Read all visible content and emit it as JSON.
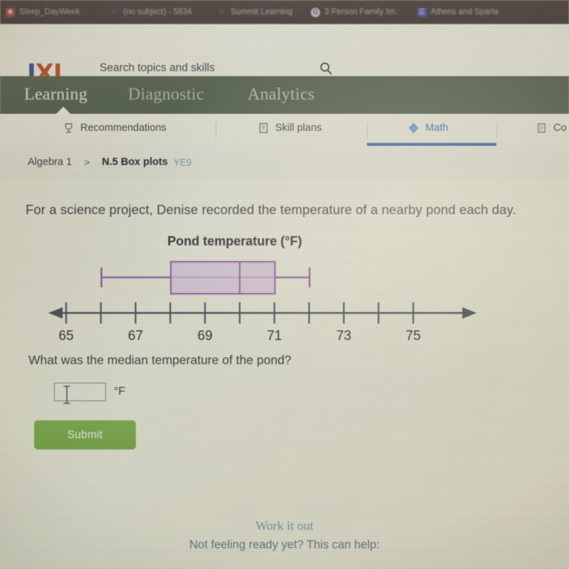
{
  "browser": {
    "bookmarks": [
      {
        "label": "Sleep_DayWeek",
        "icon": "red-dot-icon",
        "color": "#c4554a"
      },
      {
        "label": "(no subject) - 5834",
        "icon": "checkmark-icon",
        "color": "#6b5fd0"
      },
      {
        "label": "Summit Learning",
        "icon": "sun-burst-icon",
        "color": "#d05a4a"
      },
      {
        "label": "3 Person Family Im.",
        "icon": "google-g-icon",
        "color": "#e8e4e2"
      },
      {
        "label": "Athens and Sparta",
        "icon": "document-icon",
        "color": "#5a5fd8"
      }
    ]
  },
  "header": {
    "logo_i": "I",
    "logo_xl": "XL",
    "search_placeholder": "Search topics and skills",
    "search_value": "",
    "search_icon": "search-icon"
  },
  "main_nav": {
    "items": [
      {
        "label": "Learning",
        "active": true
      },
      {
        "label": "Diagnostic",
        "active": false
      },
      {
        "label": "Analytics",
        "active": false
      }
    ]
  },
  "sub_nav": {
    "items": [
      {
        "label": "Recommendations",
        "icon": "trophy-icon",
        "active": false
      },
      {
        "label": "Skill plans",
        "icon": "book-list-icon",
        "active": false
      },
      {
        "label": "Math",
        "icon": "diamond-icon",
        "active": true
      },
      {
        "label": "Co",
        "icon": "clipboard-icon",
        "active": false
      }
    ]
  },
  "breadcrumb": {
    "subject": "Algebra 1",
    "separator": ">",
    "skill": "N.5 Box plots",
    "code": "YE9"
  },
  "problem": {
    "prompt": "For a science project, Denise recorded the temperature of a nearby pond each day.",
    "question": "What was the median temperature of the pond?",
    "answer_value": "",
    "unit": "°F",
    "submit_label": "Submit"
  },
  "footer": {
    "work_it_out": "Work it out",
    "help_text": "Not feeling ready yet? This can help:"
  },
  "colors": {
    "box_fill": "#d9c2e3",
    "box_stroke": "#8f57a8",
    "axis": "#4a5260",
    "submit_green": "#7cb342",
    "active_blue": "#2f6fd0",
    "teal": "#6f9eb0"
  },
  "chart_data": {
    "type": "boxplot",
    "title": "Pond temperature (°F)",
    "xlabel": "",
    "ylabel": "",
    "xlim": [
      64.3,
      75.8
    ],
    "axis_ticks": [
      65,
      66,
      67,
      68,
      69,
      70,
      71,
      72,
      73,
      74,
      75
    ],
    "tick_labels": [
      "65",
      "",
      "67",
      "",
      "69",
      "",
      "71",
      "",
      "73",
      "",
      "75"
    ],
    "labeled_ticks": [
      65,
      67,
      69,
      71,
      73,
      75
    ],
    "grid": false,
    "legend": false,
    "series": [
      {
        "name": "Pond temperature",
        "min": 66,
        "q1": 68,
        "median": 70,
        "q3": 71,
        "max": 72
      }
    ]
  }
}
